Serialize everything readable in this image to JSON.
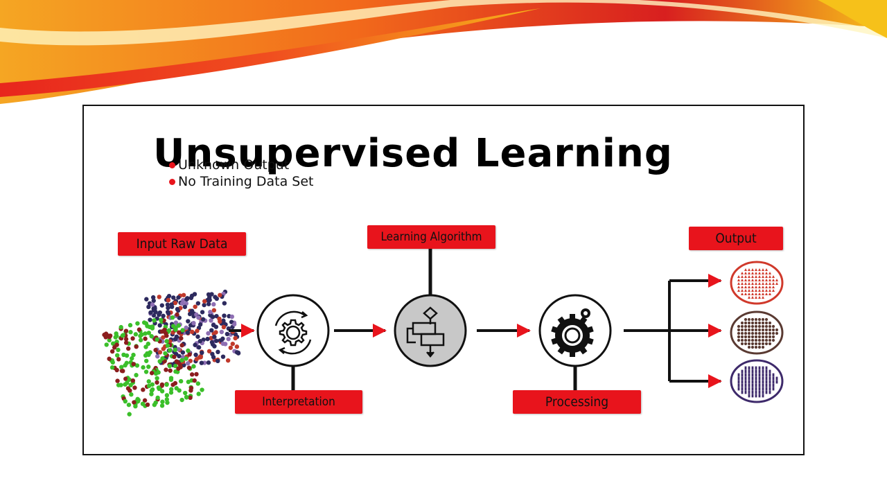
{
  "title": "Unsupervised Learning",
  "labels": {
    "input": "Input Raw Data",
    "learning_algorithm": "Learning Algorithm",
    "output": "Output",
    "interpretation": "Interpretation",
    "processing": "Processing"
  },
  "bullets": [
    "Unknown Output",
    "No Training Data Set"
  ],
  "colors": {
    "tag_red": "#e8141c",
    "arrow_red": "#e8141c",
    "output_red": "#d0392b",
    "output_brown": "#5a3a32",
    "output_purple": "#3e2a6b"
  },
  "icons": [
    "gear-cycle-icon",
    "flowchart-icon",
    "gear-processing-icon"
  ]
}
